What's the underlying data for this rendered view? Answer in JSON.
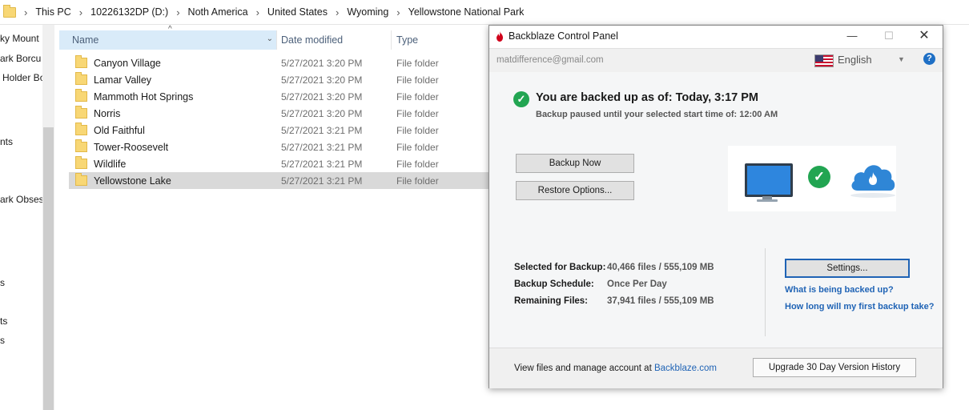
{
  "explorer": {
    "breadcrumb": [
      "This PC",
      "10226132DP (D:)",
      "Noth America",
      "United States",
      "Wyoming",
      "Yellowstone National Park"
    ],
    "nav_items": [
      "ky Mount",
      "ark Borcu",
      "Holder Bo",
      "nts",
      "ark Obses",
      "s",
      "ts",
      "s"
    ],
    "columns": {
      "name": "Name",
      "date": "Date modified",
      "type": "Type"
    },
    "rows": [
      {
        "name": "Canyon Village",
        "date": "5/27/2021 3:20 PM",
        "type": "File folder"
      },
      {
        "name": "Lamar Valley",
        "date": "5/27/2021 3:20 PM",
        "type": "File folder"
      },
      {
        "name": "Mammoth Hot Springs",
        "date": "5/27/2021 3:20 PM",
        "type": "File folder"
      },
      {
        "name": "Norris",
        "date": "5/27/2021 3:20 PM",
        "type": "File folder"
      },
      {
        "name": "Old Faithful",
        "date": "5/27/2021 3:21 PM",
        "type": "File folder"
      },
      {
        "name": "Tower-Roosevelt",
        "date": "5/27/2021 3:21 PM",
        "type": "File folder"
      },
      {
        "name": "Wildlife",
        "date": "5/27/2021 3:21 PM",
        "type": "File folder"
      },
      {
        "name": "Yellowstone Lake",
        "date": "5/27/2021 3:21 PM",
        "type": "File folder",
        "selected": true
      }
    ]
  },
  "backblaze": {
    "title": "Backblaze Control Panel",
    "window_buttons": {
      "minimize": "—",
      "maximize": "☐",
      "close": "✕"
    },
    "email": "matdifference@gmail.com",
    "language": "English",
    "help": "?",
    "status_title": "You are backed up as of: Today, 3:17 PM",
    "status_sub": "Backup paused until your selected start time of: 12:00 AM",
    "backup_now": "Backup Now",
    "restore_options": "Restore Options...",
    "info": [
      {
        "label": "Selected for Backup:",
        "value": "40,466 files / 555,109 MB"
      },
      {
        "label": "Backup Schedule:",
        "value": "Once Per Day"
      },
      {
        "label": "Remaining Files:",
        "value": "37,941 files / 555,109 MB"
      }
    ],
    "settings": "Settings...",
    "link_what": "What is being backed up?",
    "link_how_long": "How long will my first backup take?",
    "footer_text": "View files and manage account at ",
    "footer_link": "Backblaze.com",
    "upgrade": "Upgrade 30 Day Version History"
  },
  "colors": {
    "accent_blue": "#1f63b5",
    "success_green": "#22a552",
    "selection_gray": "#d9d9d9",
    "header_highlight": "#d9ebf9"
  }
}
